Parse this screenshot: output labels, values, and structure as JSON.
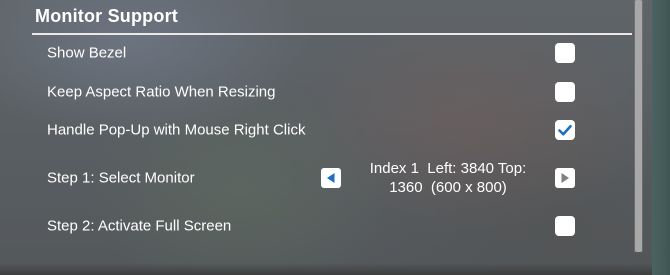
{
  "section": {
    "title": "Monitor Support"
  },
  "colors": {
    "accent": "#1f6fbf",
    "checkbox_bg": "#ffffff",
    "text": "#ffffff"
  },
  "rows": [
    {
      "label": "Show Bezel",
      "checked": false
    },
    {
      "label": "Keep Aspect Ratio When Resizing",
      "checked": false
    },
    {
      "label": "Handle Pop-Up with Mouse Right Click",
      "checked": true
    },
    {
      "label": "Step 1: Select Monitor"
    },
    {
      "label": "Step 2: Activate Full Screen",
      "checked": false
    }
  ],
  "monitor_selector": {
    "line1": "Index 1  Left: 3840 Top:",
    "line2": "1360  (600 x 800)",
    "prev_icon": "triangle-left-icon",
    "next_icon": "triangle-right-icon"
  }
}
